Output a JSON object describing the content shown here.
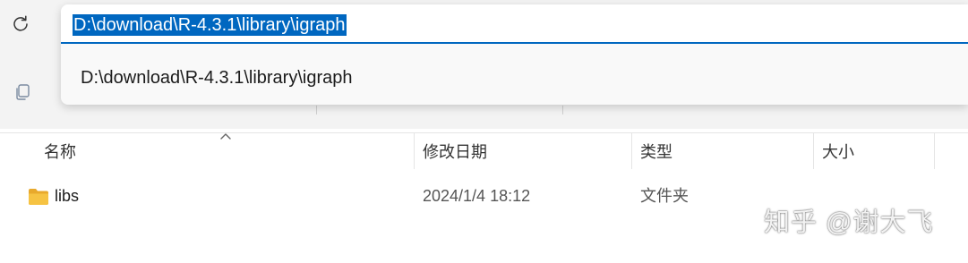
{
  "address_bar": {
    "path": "D:\\download\\R-4.3.1\\library\\igraph",
    "suggestion": "D:\\download\\R-4.3.1\\library\\igraph"
  },
  "columns": {
    "name": "名称",
    "modified": "修改日期",
    "type": "类型",
    "size": "大小"
  },
  "files": [
    {
      "name": "libs",
      "modified": "2024/1/4 18:12",
      "type": "文件夹",
      "size": ""
    }
  ],
  "watermark": "知乎 @谢大飞",
  "colors": {
    "accent": "#0067c0",
    "folder": "#f6c343"
  },
  "icons": {
    "refresh": "refresh-icon",
    "copy": "copy-icon",
    "folder": "folder-icon",
    "sort": "sort-ascending-icon"
  }
}
